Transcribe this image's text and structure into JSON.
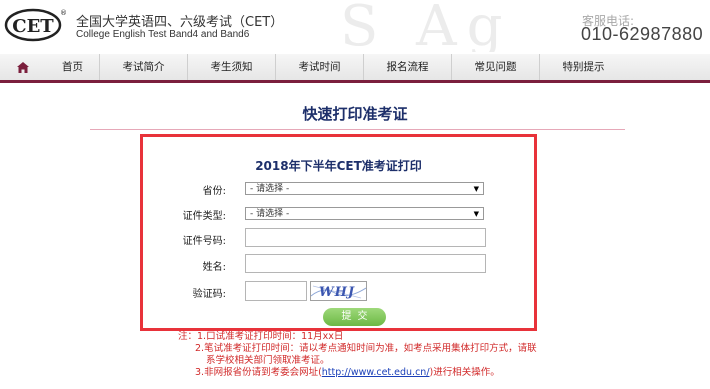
{
  "header": {
    "logo_text": "CET",
    "logo_mark": "®",
    "deco_letters": "S  Ag",
    "brand_cn": "全国大学英语四、六级考试（CET）",
    "brand_en": "College English Test Band4 and Band6",
    "hotline_label": "客服电话:",
    "hotline_number": "010-62987880"
  },
  "nav": {
    "home_icon": "home-icon",
    "items": [
      "首页",
      "考试简介",
      "考生须知",
      "考试时间",
      "报名流程",
      "常见问题",
      "特别提示"
    ]
  },
  "page": {
    "title": "快速打印准考证"
  },
  "form": {
    "title": "2018年下半年CET准考证打印",
    "province_label": "省份:",
    "province_value": "- 请选择 -",
    "id_type_label": "证件类型:",
    "id_type_value": "- 请选择 -",
    "id_number_label": "证件号码:",
    "id_number_value": "",
    "name_label": "姓名:",
    "name_value": "",
    "captcha_label": "验证码:",
    "captcha_value": "",
    "captcha_text": "WHJ",
    "submit_label": "提交"
  },
  "notes": {
    "line1": "注：1.口试准考证打印时间：11月xx日",
    "line2": "2.笔试准考证打印时间：请以考点通知时间为准，如考点采用集体打印方式，请联",
    "line3": "系学校相关部门领取准考证。",
    "line4_prefix": "3.非网报省份请到考委会网址(",
    "line4_link": "http://www.cet.edu.cn/",
    "line4_suffix": ")进行相关操作。"
  },
  "colors": {
    "nav_border": "#7b1f3d",
    "title": "#1d2f6a",
    "highlight_border": "#e8323a",
    "notes": "#d12a2a",
    "submit": "#6cb844"
  }
}
